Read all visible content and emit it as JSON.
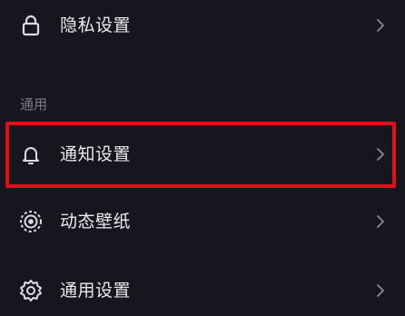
{
  "items": [
    {
      "label": "隐私设置",
      "icon": "lock-icon"
    },
    {
      "label": "通知设置",
      "icon": "bell-icon"
    },
    {
      "label": "动态壁纸",
      "icon": "wallpaper-icon"
    },
    {
      "label": "通用设置",
      "icon": "gear-icon"
    }
  ],
  "section": {
    "general_label": "通用"
  },
  "colors": {
    "background": "#16161e",
    "text": "#e9e9ee",
    "muted": "#7c7c86",
    "highlight": "#e0101b"
  }
}
